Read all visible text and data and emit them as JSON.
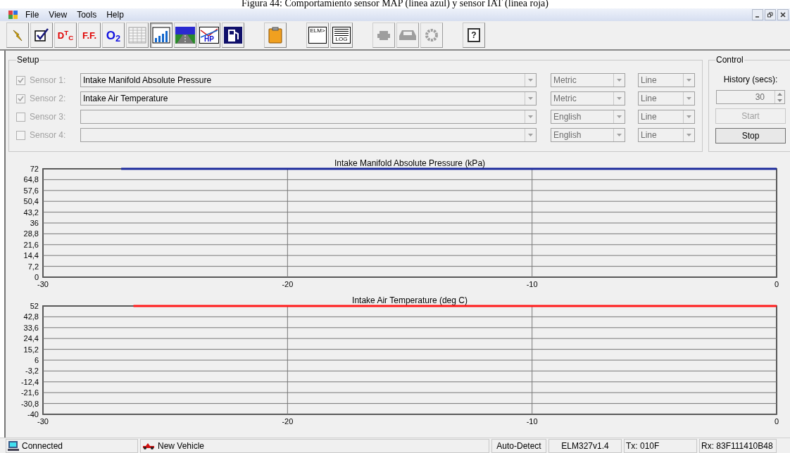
{
  "caption": "Figura 44: Comportamiento sensor MAP (línea azul) y sensor IAT (línea roja)",
  "menu": [
    "File",
    "View",
    "Tools",
    "Help"
  ],
  "toolbar": [
    {
      "kind": "lightning",
      "selected": false,
      "disabled": false
    },
    {
      "kind": "check",
      "selected": false,
      "disabled": false
    },
    {
      "kind": "dtc",
      "label": "D$^{T}$$_{C}$",
      "selected": false,
      "disabled": false
    },
    {
      "kind": "ff",
      "label": "F.F.",
      "selected": false,
      "disabled": false
    },
    {
      "kind": "o2",
      "label": "O$_{2}$",
      "selected": false,
      "disabled": false
    },
    {
      "kind": "table",
      "selected": false,
      "disabled": false
    },
    {
      "kind": "chart",
      "selected": true,
      "disabled": false
    },
    {
      "kind": "road",
      "selected": false,
      "disabled": false
    },
    {
      "kind": "hp",
      "label": "HP",
      "selected": false,
      "disabled": false
    },
    {
      "kind": "fuel",
      "selected": false,
      "disabled": false
    },
    {
      "kind": "gap"
    },
    {
      "kind": "clipboard",
      "selected": false,
      "disabled": false
    },
    {
      "kind": "gap"
    },
    {
      "kind": "elm",
      "label": "ELM>",
      "selected": false,
      "disabled": false
    },
    {
      "kind": "log",
      "label": "LOG",
      "selected": false,
      "disabled": false
    },
    {
      "kind": "gap"
    },
    {
      "kind": "engine",
      "selected": false,
      "disabled": true
    },
    {
      "kind": "car",
      "selected": false,
      "disabled": true
    },
    {
      "kind": "gear",
      "selected": false,
      "disabled": true
    },
    {
      "kind": "gap"
    },
    {
      "kind": "help",
      "label": "?",
      "selected": false,
      "disabled": false
    }
  ],
  "setup": {
    "title": "Setup",
    "sensors": [
      {
        "label": "Sensor 1:",
        "checked": true,
        "disabled": true,
        "sensor": "Intake Manifold Absolute Pressure",
        "units": "Metric",
        "style": "Line"
      },
      {
        "label": "Sensor 2:",
        "checked": true,
        "disabled": true,
        "sensor": "Intake Air Temperature",
        "units": "Metric",
        "style": "Line"
      },
      {
        "label": "Sensor 3:",
        "checked": false,
        "disabled": true,
        "units": "English",
        "style": "Line"
      },
      {
        "label": "Sensor 4:",
        "checked": false,
        "disabled": true,
        "units": "English",
        "style": "Line"
      }
    ]
  },
  "control": {
    "title": "Control",
    "history_label": "History (secs):",
    "history_value": "30",
    "buttons": [
      {
        "label": "Start",
        "disabled": true
      },
      {
        "label": "Stop",
        "disabled": false
      }
    ]
  },
  "charts": [
    {
      "chart_data": {
        "type": "line",
        "title": "Intake Manifold Absolute Pressure (kPa)",
        "xlim": [
          -30,
          0
        ],
        "ylim": [
          0,
          72
        ],
        "xticks": [
          -30,
          -20,
          -10,
          0
        ],
        "grid": true,
        "yticks": [
          0,
          {
            "value": 7.2,
            "label": "7,2"
          },
          {
            "value": 14.4,
            "label": "14,4"
          },
          {
            "value": 21.6,
            "label": "21,6"
          },
          {
            "value": 28.8,
            "label": "28,8"
          },
          36,
          {
            "value": 43.2,
            "label": "43,2"
          },
          {
            "value": 50.4,
            "label": "50,4"
          },
          {
            "value": 57.6,
            "label": "57,6"
          },
          {
            "value": 64.8,
            "label": "64,8"
          },
          72
        ],
        "x": [
          -26.8,
          0
        ],
        "series": [
          {
            "color": "#1c2a9c",
            "values": [
              72,
              72
            ]
          }
        ]
      }
    },
    {
      "chart_data": {
        "type": "line",
        "title": "Intake Air Temperature (deg C)",
        "xlim": [
          -30,
          0
        ],
        "ylim": [
          -40,
          52
        ],
        "xticks": [
          -30,
          -20,
          -10,
          0
        ],
        "grid": true,
        "yticks": [
          -40,
          {
            "value": -30.8,
            "label": "-30,8"
          },
          {
            "value": -21.6,
            "label": "-21,6"
          },
          {
            "value": -12.4,
            "label": "-12,4"
          },
          {
            "value": -3.2,
            "label": "-3,2"
          },
          6,
          {
            "value": 15.2,
            "label": "15,2"
          },
          {
            "value": 24.4,
            "label": "24,4"
          },
          {
            "value": 33.6,
            "label": "33,6"
          },
          {
            "value": 42.8,
            "label": "42,8"
          },
          52
        ],
        "x": [
          -26.3,
          0
        ],
        "series": [
          {
            "color": "#ff1a1a",
            "values": [
              52,
              52
            ]
          }
        ]
      }
    }
  ],
  "status_bar": [
    {
      "kind": "connection",
      "text": "Connected"
    },
    {
      "kind": "vehicle",
      "text": "New Vehicle"
    },
    {
      "kind": "plain",
      "text": "Auto-Detect"
    },
    {
      "kind": "plain",
      "text": "ELM327v1.4"
    },
    {
      "kind": "plain",
      "text": "Tx: 010F"
    },
    {
      "kind": "plain",
      "text": "Rx: 83F111410B48"
    }
  ]
}
